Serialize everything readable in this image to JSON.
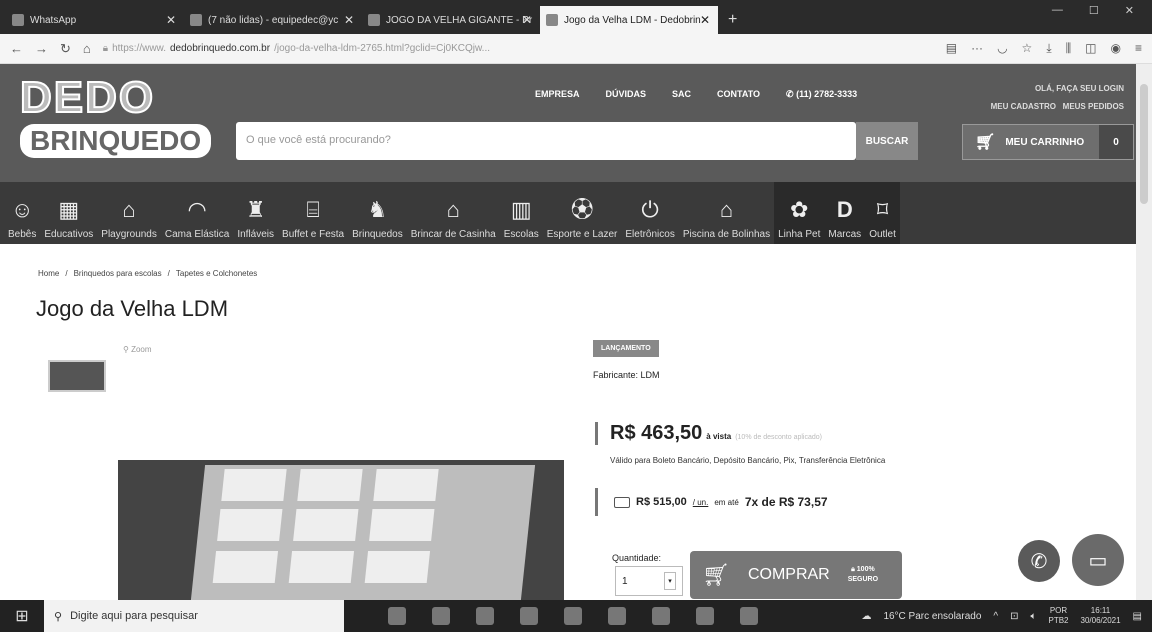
{
  "browser": {
    "tabs": [
      {
        "label": "WhatsApp",
        "active": false
      },
      {
        "label": "(7 não lidas) - equipedec@yc",
        "active": false
      },
      {
        "label": "JOGO DA VELHA GIGANTE - Pr",
        "active": false
      },
      {
        "label": "Jogo da Velha LDM - Dedobrin",
        "active": true
      }
    ],
    "url_prefix": "https://www.",
    "url_domain": "dedobrinquedo.com.br",
    "url_path": "/jogo-da-velha-ldm-2765.html?gclid=Cj0KCQjw..."
  },
  "header": {
    "logo_top": "DEDO",
    "logo_bottom": "BRINQUEDO",
    "nav": [
      "EMPRESA",
      "DÚVIDAS",
      "SAC",
      "CONTATO",
      "(11) 2782-3333"
    ],
    "login": "OLÁ, FAÇA SEU LOGIN",
    "account": [
      "MEU CADASTRO",
      "MEUS PEDIDOS"
    ],
    "search_placeholder": "O que você está procurando?",
    "search_button": "BUSCAR",
    "cart_label": "MEU CARRINHO",
    "cart_count": "0"
  },
  "categories": [
    {
      "label": "Bebês",
      "icon": "baby-icon"
    },
    {
      "label": "Educativos",
      "icon": "blocks-icon"
    },
    {
      "label": "Playgrounds",
      "icon": "playground-icon"
    },
    {
      "label": "Cama Elástica",
      "icon": "trampoline-icon"
    },
    {
      "label": "Infláveis",
      "icon": "inflatable-icon"
    },
    {
      "label": "Buffet e Festa",
      "icon": "buffet-icon"
    },
    {
      "label": "Brinquedos",
      "icon": "rocking-horse-icon"
    },
    {
      "label": "Brincar de Casinha",
      "icon": "playhouse-icon"
    },
    {
      "label": "Escolas",
      "icon": "school-icon"
    },
    {
      "label": "Esporte e Lazer",
      "icon": "ball-icon"
    },
    {
      "label": "Eletrônicos",
      "icon": "plug-icon"
    },
    {
      "label": "Piscina de Bolinhas",
      "icon": "ball-pit-icon"
    },
    {
      "label": "Linha Pet",
      "icon": "paw-icon"
    },
    {
      "label": "Marcas",
      "icon": "brand-icon"
    },
    {
      "label": "Outlet",
      "icon": "tag-icon"
    }
  ],
  "breadcrumb": [
    "Home",
    "Brinquedos para escolas",
    "Tapetes e Colchonetes"
  ],
  "product": {
    "title": "Jogo da Velha LDM",
    "zoom": "Zoom",
    "badge": "LANÇAMENTO",
    "maker": "Fabricante: LDM",
    "price": "R$ 463,50",
    "price_suffix": "à vista",
    "discount_note": "(10% de desconto aplicado)",
    "payment_methods": "Válido para Boleto Bancário, Depósito Bancário, Pix, Transferência Eletrônica",
    "install_price": "R$ 515,00",
    "install_unit": "/ un.",
    "install_text": "em até",
    "install_plan": "7x de R$ 73,57",
    "qty_label": "Quantidade:",
    "qty_value": "1",
    "buy_label": "COMPRAR",
    "secure_pct": "100%",
    "secure_label": "SEGURO"
  },
  "taskbar": {
    "search_placeholder": "Digite aqui para pesquisar",
    "weather": "16°C Parc ensolarado",
    "lang1": "POR",
    "lang2": "PTB2",
    "time": "16:11",
    "date": "30/06/2021"
  }
}
